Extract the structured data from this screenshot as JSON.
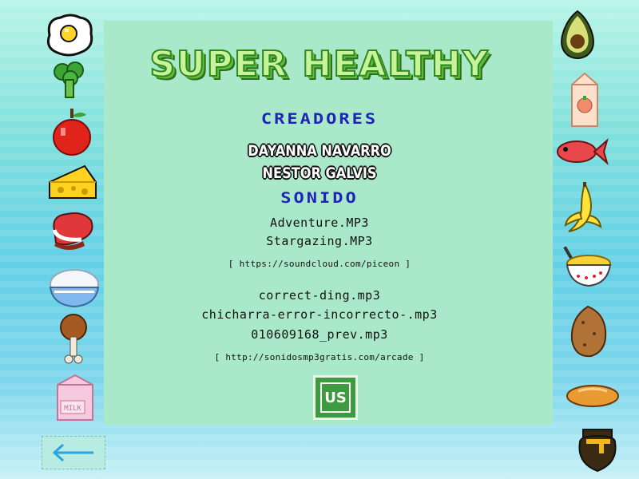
{
  "title": "SUPER HEALTHY",
  "credits": {
    "creators_heading": "CREADORES",
    "creators": [
      "DAYANNA NAVARRO",
      "NESTOR GALVIS"
    ],
    "sound_heading": "SONIDO",
    "music_tracks": [
      "Adventure.MP3",
      "Stargazing.MP3"
    ],
    "music_source": "[ https://soundcloud.com/piceon ]",
    "sfx_tracks": [
      "correct-ding.mp3",
      "chicharra-error-incorrecto-.mp3",
      "010609168_prev.mp3"
    ],
    "sfx_source": "[ http://sonidosmp3gratis.com/arcade ]"
  },
  "logo": {
    "text": "US"
  },
  "food_icons_left": [
    "egg-icon",
    "broccoli-icon",
    "apple-icon",
    "cheese-icon",
    "steak-icon",
    "rice-bowl-icon",
    "chicken-leg-icon",
    "milk-carton-icon"
  ],
  "food_icons_left_labels": {
    "milk": "MILK"
  },
  "food_icons_right": [
    "avocado-icon",
    "juice-carton-icon",
    "fish-icon",
    "banana-icon",
    "noodle-bowl-icon",
    "potato-icon",
    "bread-icon",
    "honey-pot-icon"
  ],
  "back_button": {
    "icon": "arrow-left-icon"
  },
  "colors": {
    "panel": "#a9e9c9",
    "heading": "#1e25b8",
    "title_fill": "#c8f39a",
    "title_outline": "#2c8a1e"
  }
}
